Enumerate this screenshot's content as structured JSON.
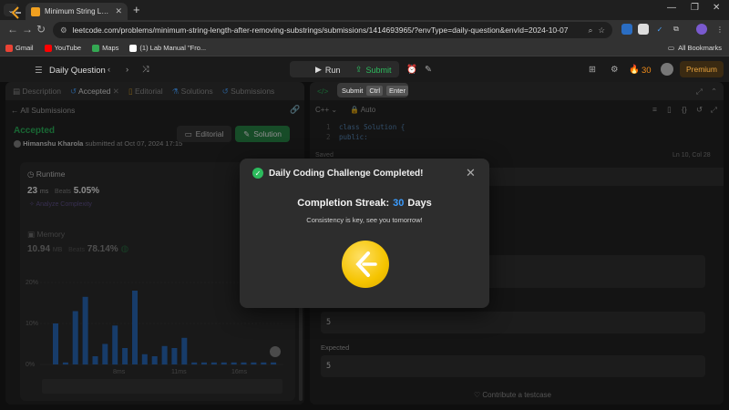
{
  "browser": {
    "tab_title": "Minimum String Length After R",
    "url": "leetcode.com/problems/minimum-string-length-after-removing-substrings/submissions/1414693965/?envType=daily-question&envId=2024-10-07",
    "bookmarks": [
      {
        "label": "Gmail",
        "color": "#ea4335"
      },
      {
        "label": "YouTube",
        "color": "#ff0000"
      },
      {
        "label": "Maps",
        "color": "#34a853"
      },
      {
        "label": "(1) Lab Manual \"Fro...",
        "color": "#ffffff"
      }
    ],
    "all_bookmarks": "All Bookmarks"
  },
  "header": {
    "daily_question": "Daily Question",
    "run": "Run",
    "submit": "Submit",
    "streak_count": "30",
    "premium": "Premium"
  },
  "tooltip": {
    "label": "Submit",
    "key1": "Ctrl",
    "key2": "Enter"
  },
  "left_tabs": [
    {
      "label": "Description"
    },
    {
      "label": "Accepted"
    },
    {
      "label": "Editorial"
    },
    {
      "label": "Solutions"
    },
    {
      "label": "Submissions"
    }
  ],
  "submission": {
    "back_label": "All Submissions",
    "status": "Accepted",
    "user": "Himanshu Kharola",
    "submitted_at": "submitted at Oct 07, 2024 17:15",
    "editorial_btn": "Editorial",
    "solution_btn": "Solution",
    "runtime_label": "Runtime",
    "runtime_value": "23",
    "runtime_unit": "ms",
    "beats_label": "Beats",
    "runtime_beats": "5.05%",
    "analyze": "Analyze Complexity",
    "memory_label": "Memory",
    "memory_value": "10.94",
    "memory_unit": "MB",
    "memory_beats": "78.14%",
    "y_ticks": [
      "20%",
      "10%",
      "0%"
    ],
    "x_ticks": [
      "8ms",
      "11ms",
      "16ms"
    ]
  },
  "chart_data": {
    "type": "bar",
    "ylim": [
      0,
      22
    ],
    "values": [
      10,
      0.5,
      13,
      16.5,
      2,
      5,
      9.5,
      4,
      18,
      2.5,
      2,
      4.5,
      4,
      6.5,
      0.5,
      0.5,
      0.5,
      0.5,
      0.5,
      0.5,
      0.5,
      0.5,
      0.5
    ],
    "x_ticks": [
      "8ms",
      "11ms",
      "16ms"
    ],
    "y_ticks": [
      "0%",
      "10%",
      "20%"
    ]
  },
  "editor": {
    "language": "C++",
    "auto": "Auto",
    "line1": "class Solution {",
    "line2": "public:",
    "saved": "Saved",
    "cursor": "Ln 10, Col 28",
    "output_value": "5",
    "expected_label": "Expected",
    "expected_value": "5",
    "contribute": "Contribute a testcase"
  },
  "modal": {
    "title": "Daily Coding Challenge Completed!",
    "streak_prefix": "Completion Streak:",
    "streak_number": "30",
    "streak_suffix": "Days",
    "tagline": "Consistency is key, see you tomorrow!"
  }
}
